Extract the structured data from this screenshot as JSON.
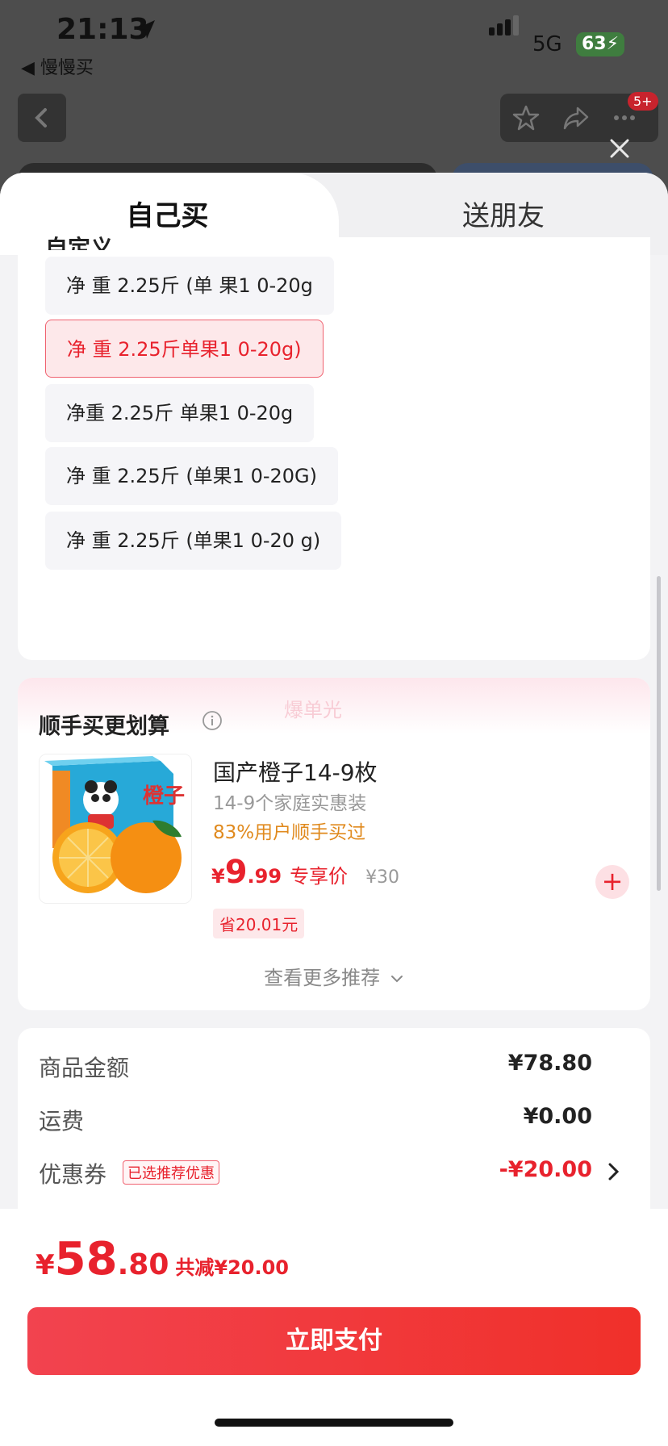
{
  "status_bar": {
    "time": "21:13",
    "back_app": "◀ 慢慢买",
    "network": "5G",
    "battery": "63"
  },
  "header": {
    "notification_badge": "5+"
  },
  "tabs": [
    {
      "label": "自己买",
      "active": true
    },
    {
      "label": "送朋友",
      "active": false
    }
  ],
  "spec": {
    "heading": "自定义",
    "options": [
      {
        "label": "净 重 2.25斤 (单 果1 0-20g",
        "selected": false
      },
      {
        "label": "净  重 2.25斤单果1 0-20g)",
        "selected": true
      },
      {
        "label": "净重 2.25斤 单果1 0-20g",
        "selected": false
      },
      {
        "label": "净 重  2.25斤 (单果1 0-20G)",
        "selected": false
      },
      {
        "label": "净 重 2.25斤 (单果1 0-20 g)",
        "selected": false
      }
    ]
  },
  "recommend": {
    "watermark": "爆单光",
    "title": "顺手买更划算",
    "product": {
      "image_text": "橙子",
      "name": "国产橙子14-9枚",
      "subtitle": "14-9个家庭实惠装",
      "bought_rate": "83%用户顺手买过",
      "price_symbol": "¥",
      "price_int": "9",
      "price_dec": ".99",
      "price_tag": "专享价",
      "original_price": "¥30",
      "save_text": "省20.01元",
      "add_label": "+"
    },
    "more_link": "查看更多推荐"
  },
  "summary": {
    "rows": [
      {
        "label": "商品金额",
        "value": "¥78.80"
      },
      {
        "label": "运费",
        "value": "¥0.00"
      },
      {
        "label": "优惠券",
        "badge": "已选推荐优惠",
        "value": "-¥20.00"
      }
    ]
  },
  "footer": {
    "total_symbol": "¥",
    "total_int": "58",
    "total_dec": ".80",
    "total_reduce": "共减¥20.00",
    "pay_label": "立即支付"
  },
  "colors": {
    "accent_red": "#e8222d",
    "orange_text": "#e08a1e"
  }
}
